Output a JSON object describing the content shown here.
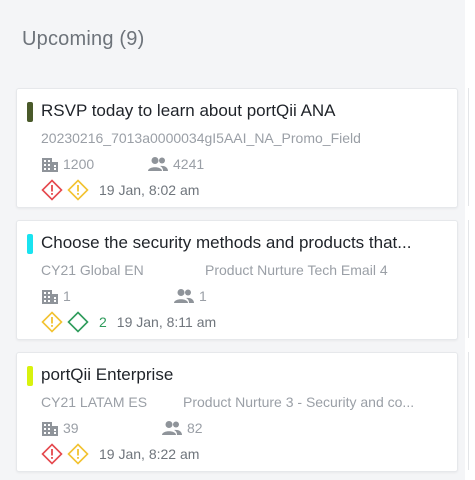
{
  "header": {
    "title": "Upcoming (9)"
  },
  "cards": [
    {
      "color": "#4a5a2a",
      "title": "RSVP today to learn about portQii ANA",
      "subtitle_left": "20230216_7013a0000034gI5AAI_NA_Promo_Field",
      "subtitle_right": "",
      "company_count": "1200",
      "people_count": "4241",
      "alerts": [
        "error-diamond-icon",
        "warning-diamond-icon"
      ],
      "success_count": "",
      "time": "19 Jan, 8:02 am"
    },
    {
      "color": "#19e3f0",
      "title": "Choose the security methods and products that...",
      "subtitle_left": "CY21 Global EN",
      "subtitle_right": "Product Nurture Tech Email 4",
      "company_count": "1",
      "people_count": "1",
      "alerts": [
        "warning-diamond-icon",
        "success-diamond-icon"
      ],
      "success_count": "2",
      "time": "19 Jan, 8:11 am"
    },
    {
      "color": "#d8f20e",
      "title": "portQii Enterprise",
      "subtitle_left": "CY21 LATAM ES",
      "subtitle_right": "Product Nurture 3 - Security and co...",
      "company_count": "39",
      "people_count": "82",
      "alerts": [
        "error-diamond-icon",
        "warning-diamond-icon"
      ],
      "success_count": "",
      "time": "19 Jan, 8:22 am"
    }
  ],
  "colors": {
    "error": "#e5484d",
    "warning": "#f2c230",
    "success": "#2e9b5b"
  }
}
